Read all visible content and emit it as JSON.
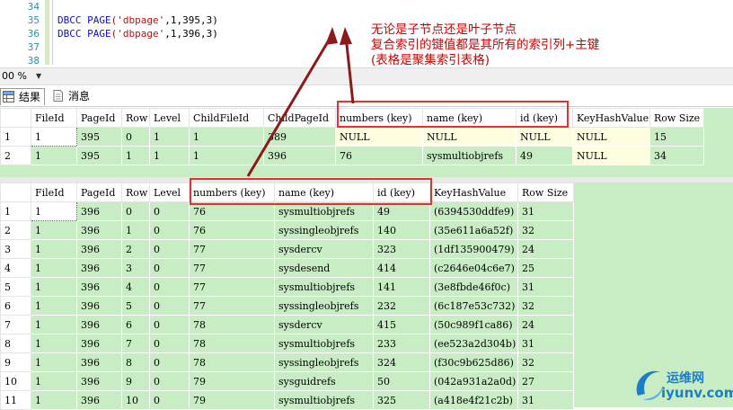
{
  "editor": {
    "line_numbers": [
      "34",
      "35",
      "36",
      "37",
      "38"
    ],
    "lines": [
      {
        "kw": "",
        "rest": ""
      },
      {
        "kw": "DBCC PAGE",
        "str": "('dbpage'",
        "rest": ",1,395,3)"
      },
      {
        "kw": "DBCC PAGE",
        "str": "('dbpage'",
        "rest": ",1,396,3)"
      },
      {
        "kw": "",
        "rest": ""
      },
      {
        "kw": "",
        "rest": ""
      }
    ]
  },
  "zoom": {
    "value": "00 %"
  },
  "tabs": [
    {
      "label": "结果",
      "icon": "grid-icon"
    },
    {
      "label": "消息",
      "icon": "message-icon"
    }
  ],
  "annotation": {
    "lines": [
      "无论是子节点还是叶子节点",
      "复合索引的键值都是其所有的索引列+主键",
      "(表格是聚集索引表格)"
    ],
    "color": "#cc0000"
  },
  "grid1": {
    "columns": [
      "FileId",
      "PageId",
      "Row",
      "Level",
      "ChildFileId",
      "ChildPageId",
      "numbers (key)",
      "name (key)",
      "id (key)",
      "KeyHashValue",
      "Row Size"
    ],
    "rows": [
      [
        "1",
        "1",
        "395",
        "0",
        "1",
        "1",
        "389",
        "NULL",
        "NULL",
        "NULL",
        "NULL",
        "15"
      ],
      [
        "2",
        "1",
        "395",
        "1",
        "1",
        "1",
        "396",
        "76",
        "sysmultiobjrefs",
        "49",
        "NULL",
        "34"
      ]
    ]
  },
  "grid2": {
    "columns": [
      "FileId",
      "PageId",
      "Row",
      "Level",
      "numbers (key)",
      "name (key)",
      "id (key)",
      "KeyHashValue",
      "Row Size"
    ],
    "rows": [
      [
        "1",
        "1",
        "396",
        "0",
        "0",
        "76",
        "sysmultiobjrefs",
        "49",
        "(6394530ddfe9)",
        "31"
      ],
      [
        "2",
        "1",
        "396",
        "1",
        "0",
        "76",
        "syssingleobjrefs",
        "140",
        "(35e611a6a52f)",
        "32"
      ],
      [
        "3",
        "1",
        "396",
        "2",
        "0",
        "77",
        "sysdercv",
        "323",
        "(1df135900479)",
        "24"
      ],
      [
        "4",
        "1",
        "396",
        "3",
        "0",
        "77",
        "sysdesend",
        "414",
        "(c2646e04c6e7)",
        "25"
      ],
      [
        "5",
        "1",
        "396",
        "4",
        "0",
        "77",
        "sysmultiobjrefs",
        "141",
        "(3e8fbde46f0c)",
        "31"
      ],
      [
        "6",
        "1",
        "396",
        "5",
        "0",
        "77",
        "syssingleobjrefs",
        "232",
        "(6c187e53c732)",
        "32"
      ],
      [
        "7",
        "1",
        "396",
        "6",
        "0",
        "78",
        "sysdercv",
        "415",
        "(50c989f1ca86)",
        "24"
      ],
      [
        "8",
        "1",
        "396",
        "7",
        "0",
        "78",
        "sysmultiobjrefs",
        "233",
        "(ee523a2d304b)",
        "31"
      ],
      [
        "9",
        "1",
        "396",
        "8",
        "0",
        "78",
        "syssingleobjrefs",
        "324",
        "(f30c9b625d86)",
        "32"
      ],
      [
        "10",
        "1",
        "396",
        "9",
        "0",
        "79",
        "sysguidrefs",
        "50",
        "(042a931a2a0d)",
        "27"
      ],
      [
        "11",
        "1",
        "396",
        "10",
        "0",
        "79",
        "sysmultiobjrefs",
        "325",
        "(a418e4f21c2b)",
        "31"
      ]
    ]
  },
  "watermark": {
    "line1": "运维网",
    "line2": "iyunv.com"
  }
}
